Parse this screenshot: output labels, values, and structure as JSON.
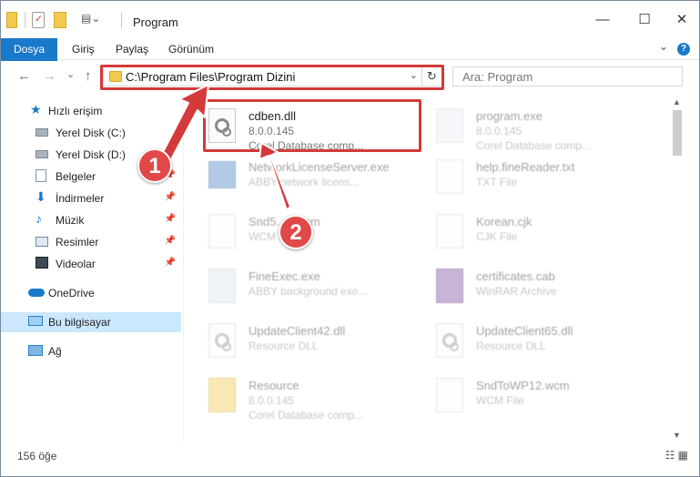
{
  "window": {
    "title": "Program",
    "minimize": "—",
    "maximize": "☐",
    "close": "✕"
  },
  "ribbon": {
    "tabs": [
      "Dosya",
      "Giriş",
      "Paylaş",
      "Görünüm"
    ],
    "help": "?"
  },
  "nav": {
    "back": "←",
    "forward": "→",
    "recent": "⌄",
    "up": "↑",
    "address": "C:\\Program Files\\Program Dizini",
    "address_dropdown": "⌄",
    "refresh": "↻",
    "search_placeholder": "Ara: Program"
  },
  "sidebar": {
    "quick_access": "Hızlı erişim",
    "items": [
      {
        "label": "Yerel Disk (C:)",
        "pinned": false
      },
      {
        "label": "Yerel Disk (D:)",
        "pinned": true
      },
      {
        "label": "Belgeler",
        "pinned": true
      },
      {
        "label": "İndirmeler",
        "pinned": true
      },
      {
        "label": "Müzik",
        "pinned": true
      },
      {
        "label": "Resimler",
        "pinned": true
      },
      {
        "label": "Videolar",
        "pinned": true
      }
    ],
    "onedrive": "OneDrive",
    "this_pc": "Bu bilgisayar",
    "network": "Ağ"
  },
  "files": [
    {
      "name": "cdben.dll",
      "line2": "8.0.0.145",
      "line3": "Corel Database comp...",
      "focus": true
    },
    {
      "name": "program.exe",
      "line2": "8.0.0.145",
      "line3": "Corel Database comp...",
      "focus": false
    },
    {
      "name": "NetworkLicenseServer.exe",
      "line2": "ABBY network licens...",
      "line3": "",
      "focus": false
    },
    {
      "name": "help.fineReader.txt",
      "line2": "TXT File",
      "line3": "",
      "focus": false
    },
    {
      "name": "Snd5...4.wcm",
      "line2": "WCM File",
      "line3": "",
      "focus": false
    },
    {
      "name": "Korean.cjk",
      "line2": "CJK File",
      "line3": "",
      "focus": false
    },
    {
      "name": "FineExec.exe",
      "line2": "ABBY background exe...",
      "line3": "",
      "focus": false
    },
    {
      "name": "certificates.cab",
      "line2": "WinRAR Archive",
      "line3": "",
      "focus": false
    },
    {
      "name": "UpdateClient42.dll",
      "line2": "Resource DLL",
      "line3": "",
      "focus": false
    },
    {
      "name": "UpdateClient65.dll",
      "line2": "Resource DLL",
      "line3": "",
      "focus": false
    },
    {
      "name": "Resource",
      "line2": "8.0.0.145",
      "line3": "Corel Database comp...",
      "focus": false
    },
    {
      "name": "SndToWP12.wcm",
      "line2": "WCM File",
      "line3": "",
      "focus": false
    }
  ],
  "annotations": {
    "step1": "1",
    "step2": "2",
    "color": "#d43a3a"
  },
  "status": {
    "count": "156 öğe"
  }
}
